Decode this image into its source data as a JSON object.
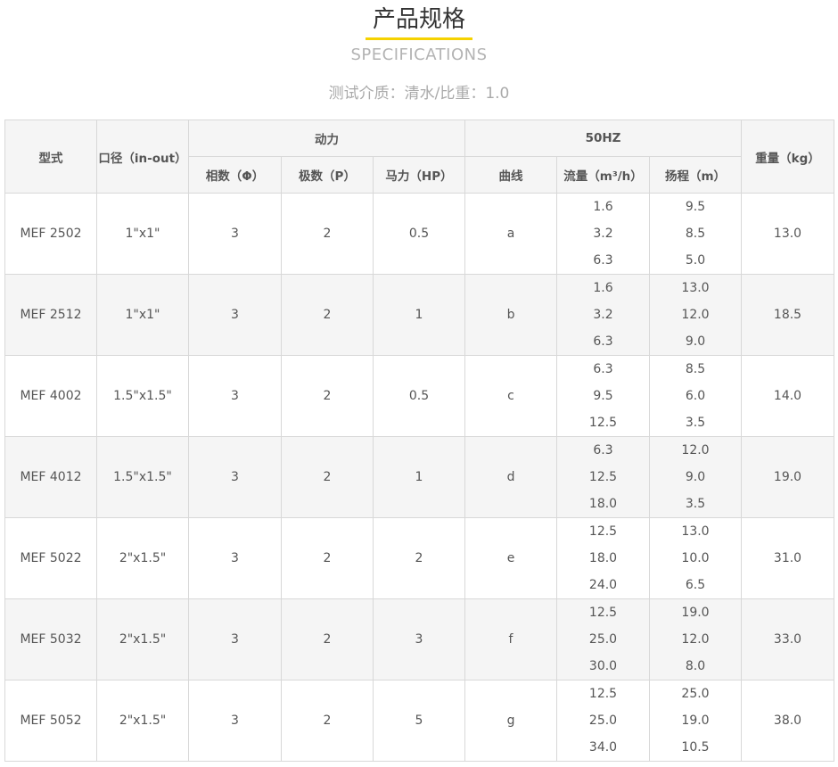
{
  "header": {
    "title": "产品规格",
    "subtitle": "SPECIFICATIONS",
    "medium": "测试介质：清水/比重：1.0"
  },
  "colors": {
    "underline": "#f5d200",
    "header_bg": "#f5f5f5",
    "alt_row_bg": "#f5f5f5",
    "border": "#d8d8d8"
  },
  "table": {
    "headers": {
      "model": "型式",
      "port": "口径（in-out）",
      "power": "动力",
      "hz": "50HZ",
      "weight": "重量（kg）",
      "phase": "相数（Φ）",
      "poles": "极数（P）",
      "hp": "马力（HP）",
      "curve": "曲线",
      "flow": "流量（m³/h）",
      "head": "扬程（m）"
    },
    "rows": [
      {
        "model": "MEF 2502",
        "port": "1\"x1\"",
        "phase": "3",
        "poles": "2",
        "hp": "0.5",
        "curve": "a",
        "flow": [
          "1.6",
          "3.2",
          "6.3"
        ],
        "head": [
          "9.5",
          "8.5",
          "5.0"
        ],
        "weight": "13.0"
      },
      {
        "model": "MEF 2512",
        "port": "1\"x1\"",
        "phase": "3",
        "poles": "2",
        "hp": "1",
        "curve": "b",
        "flow": [
          "1.6",
          "3.2",
          "6.3"
        ],
        "head": [
          "13.0",
          "12.0",
          "9.0"
        ],
        "weight": "18.5"
      },
      {
        "model": "MEF 4002",
        "port": "1.5\"x1.5\"",
        "phase": "3",
        "poles": "2",
        "hp": "0.5",
        "curve": "c",
        "flow": [
          "6.3",
          "9.5",
          "12.5"
        ],
        "head": [
          "8.5",
          "6.0",
          "3.5"
        ],
        "weight": "14.0"
      },
      {
        "model": "MEF 4012",
        "port": "1.5\"x1.5\"",
        "phase": "3",
        "poles": "2",
        "hp": "1",
        "curve": "d",
        "flow": [
          "6.3",
          "12.5",
          "18.0"
        ],
        "head": [
          "12.0",
          "9.0",
          "3.5"
        ],
        "weight": "19.0"
      },
      {
        "model": "MEF 5022",
        "port": "2\"x1.5\"",
        "phase": "3",
        "poles": "2",
        "hp": "2",
        "curve": "e",
        "flow": [
          "12.5",
          "18.0",
          "24.0"
        ],
        "head": [
          "13.0",
          "10.0",
          "6.5"
        ],
        "weight": "31.0"
      },
      {
        "model": "MEF 5032",
        "port": "2\"x1.5\"",
        "phase": "3",
        "poles": "2",
        "hp": "3",
        "curve": "f",
        "flow": [
          "12.5",
          "25.0",
          "30.0"
        ],
        "head": [
          "19.0",
          "12.0",
          "8.0"
        ],
        "weight": "33.0"
      },
      {
        "model": "MEF 5052",
        "port": "2\"x1.5\"",
        "phase": "3",
        "poles": "2",
        "hp": "5",
        "curve": "g",
        "flow": [
          "12.5",
          "25.0",
          "34.0"
        ],
        "head": [
          "25.0",
          "19.0",
          "10.5"
        ],
        "weight": "38.0"
      }
    ]
  }
}
